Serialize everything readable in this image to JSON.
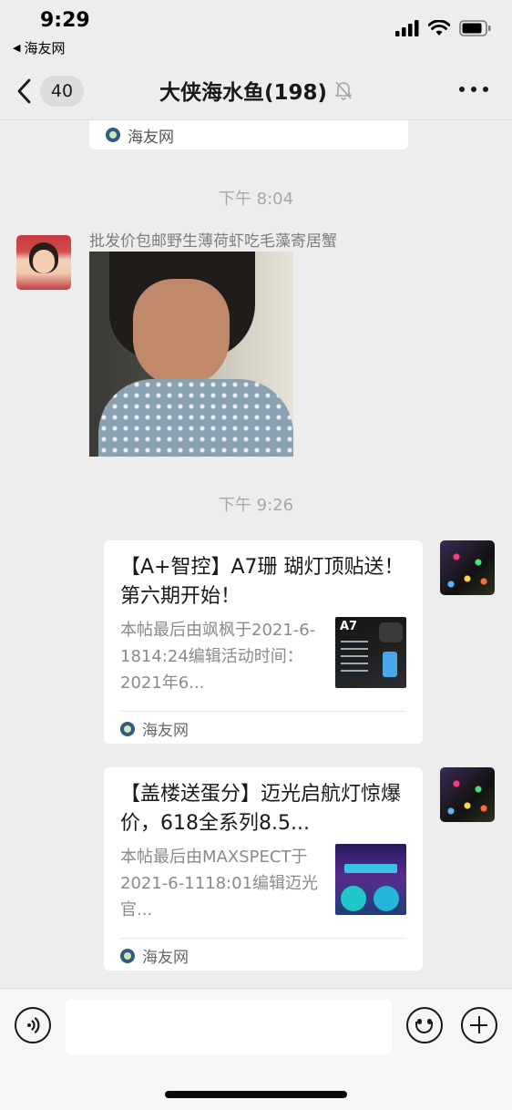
{
  "status_bar": {
    "time": "9:29",
    "back_app": "海友网"
  },
  "nav": {
    "unread_count": "40",
    "title": "大侠海水鱼(198)"
  },
  "chat": {
    "prev_card_source": "海友网",
    "messages": [
      {
        "timestamp": "下午 8:04"
      },
      {
        "sender": "批发价包邮野生薄荷虾吃毛藻寄居蟹"
      },
      {
        "timestamp": "下午 9:26"
      }
    ],
    "cards": [
      {
        "title": "【A+智控】A7珊 瑚灯顶贴送！第六期开始！",
        "desc": "本帖最后由飒枫于2021-6-1814:24编辑活动时间：2021年6...",
        "thumb_label": "A7",
        "source": "海友网"
      },
      {
        "title": "【盖楼送蛋分】迈光启航灯惊爆价，618全系列8.5...",
        "desc": "本帖最后由MAXSPECT于2021-6-1118:01编辑迈光官...",
        "source": "海友网"
      }
    ]
  },
  "input_bar": {
    "placeholder": ""
  },
  "colors": {
    "background": "#ededed",
    "card": "#ffffff",
    "timestamp": "#a8a8a8"
  }
}
